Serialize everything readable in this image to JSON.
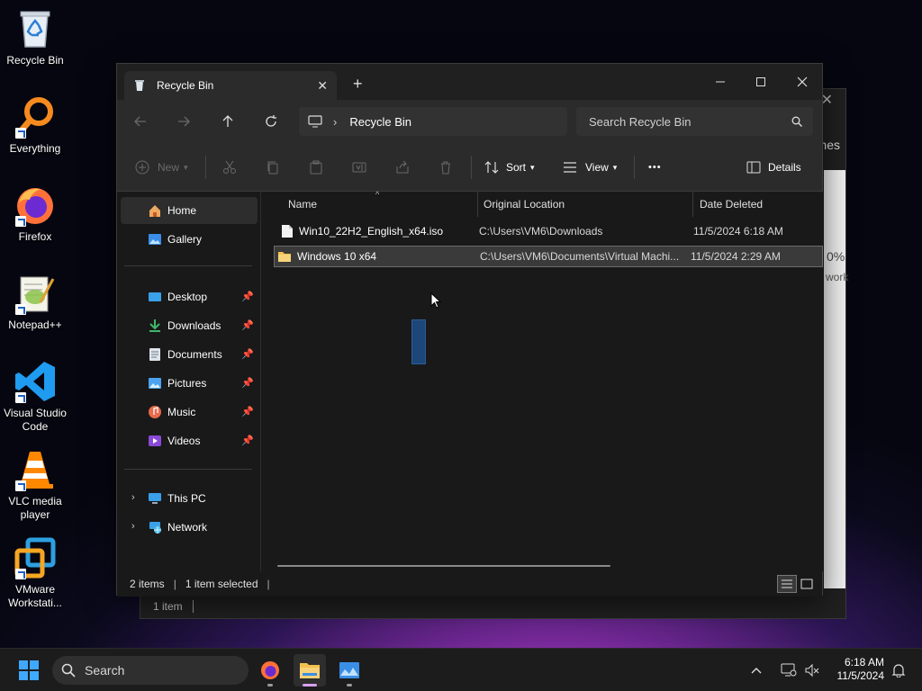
{
  "desktop": {
    "icons": [
      {
        "label": "Recycle Bin",
        "icon": "recycle-bin-icon"
      },
      {
        "label": "Everything",
        "icon": "everything-search-icon"
      },
      {
        "label": "Firefox",
        "icon": "firefox-icon"
      },
      {
        "label": "Notepad++",
        "icon": "notepad-plus-plus-icon"
      },
      {
        "label": "Visual Studio Code",
        "icon": "vscode-icon"
      },
      {
        "label": "VLC media player",
        "icon": "vlc-icon"
      },
      {
        "label": "VMware Workstati...",
        "icon": "vmware-icon"
      }
    ]
  },
  "background_window": {
    "status": "1 item",
    "partial_text": {
      "nes": "nes",
      "zero_pct": "0%",
      "work": "work"
    }
  },
  "window": {
    "tab_title": "Recycle Bin",
    "new_tab": "+",
    "breadcrumb": [
      "Recycle Bin"
    ],
    "search_placeholder": "Search Recycle Bin",
    "commands": {
      "new": "New",
      "sort": "Sort",
      "view": "View",
      "more": "•••",
      "details": "Details"
    },
    "sidebar": {
      "home": "Home",
      "gallery": "Gallery",
      "pinned": [
        {
          "label": "Desktop",
          "icon": "desktop-icon"
        },
        {
          "label": "Downloads",
          "icon": "download-icon"
        },
        {
          "label": "Documents",
          "icon": "documents-icon"
        },
        {
          "label": "Pictures",
          "icon": "pictures-icon"
        },
        {
          "label": "Music",
          "icon": "music-icon"
        },
        {
          "label": "Videos",
          "icon": "videos-icon"
        }
      ],
      "this_pc": "This PC",
      "network": "Network"
    },
    "columns": {
      "name": "Name",
      "location": "Original Location",
      "date": "Date Deleted"
    },
    "files": [
      {
        "name": "Win10_22H2_English_x64.iso",
        "type": "file",
        "location": "C:\\Users\\VM6\\Downloads",
        "date": "11/5/2024 6:18 AM",
        "selected": false
      },
      {
        "name": "Windows 10 x64",
        "type": "folder",
        "location": "C:\\Users\\VM6\\Documents\\Virtual Machi...",
        "date": "11/5/2024 2:29 AM",
        "selected": true
      }
    ],
    "status": {
      "items": "2 items",
      "selected": "1 item selected"
    }
  },
  "taskbar": {
    "search": "Search",
    "time": "6:18 AM",
    "date": "11/5/2024"
  },
  "colors": {
    "accent_folder": "#f2c14e",
    "selection_bg": "#3a3a3a",
    "window_bg": "#191919",
    "command_bar_bg": "#2b2b2b"
  }
}
